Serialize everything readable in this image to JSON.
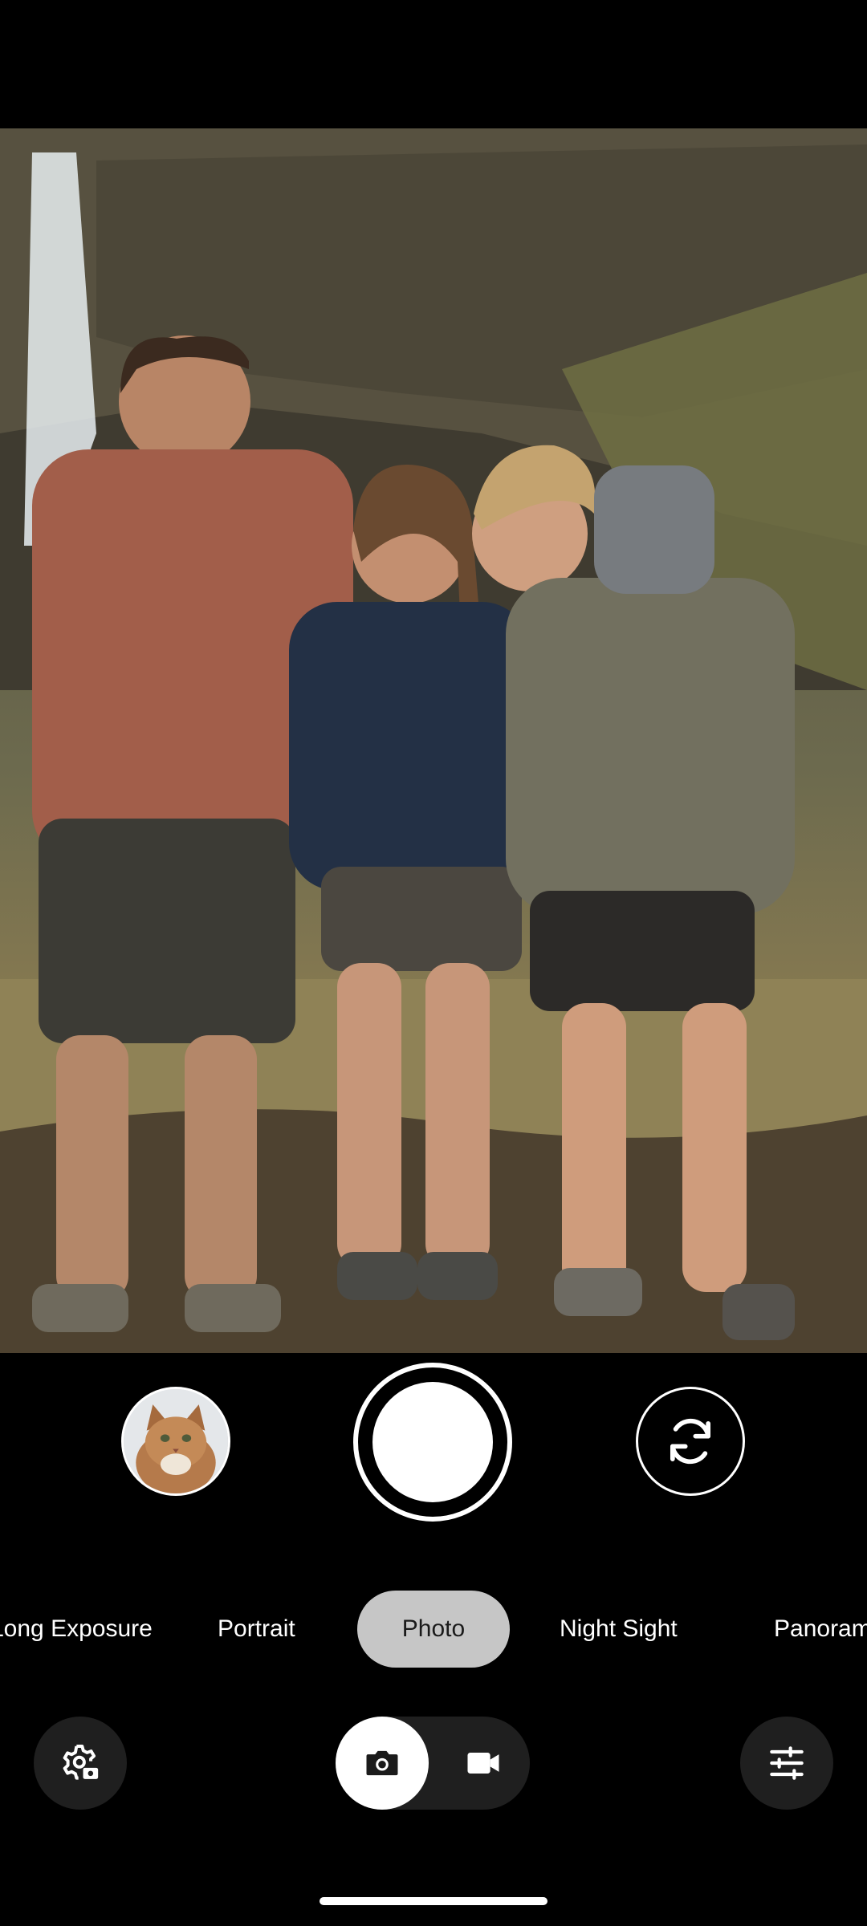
{
  "viewfinder": {
    "description_icon": "camera-preview"
  },
  "controls": {
    "gallery_icon": "gallery-thumbnail-icon",
    "shutter_icon": "shutter-icon",
    "flip_icon": "flip-camera-icon"
  },
  "modes": {
    "items": [
      "Long Exposure",
      "Portrait",
      "Photo",
      "Night Sight",
      "Panorama"
    ],
    "selected": "Photo"
  },
  "bottom_bar": {
    "settings_icon": "camera-settings-icon",
    "photo_icon": "camera-icon",
    "video_icon": "video-camera-icon",
    "adjust_icon": "sliders-icon"
  },
  "colors": {
    "background": "#000000",
    "active_mode_pill": "#c6c6c6",
    "button_bg": "#1f1f1f",
    "foreground": "#ffffff"
  }
}
